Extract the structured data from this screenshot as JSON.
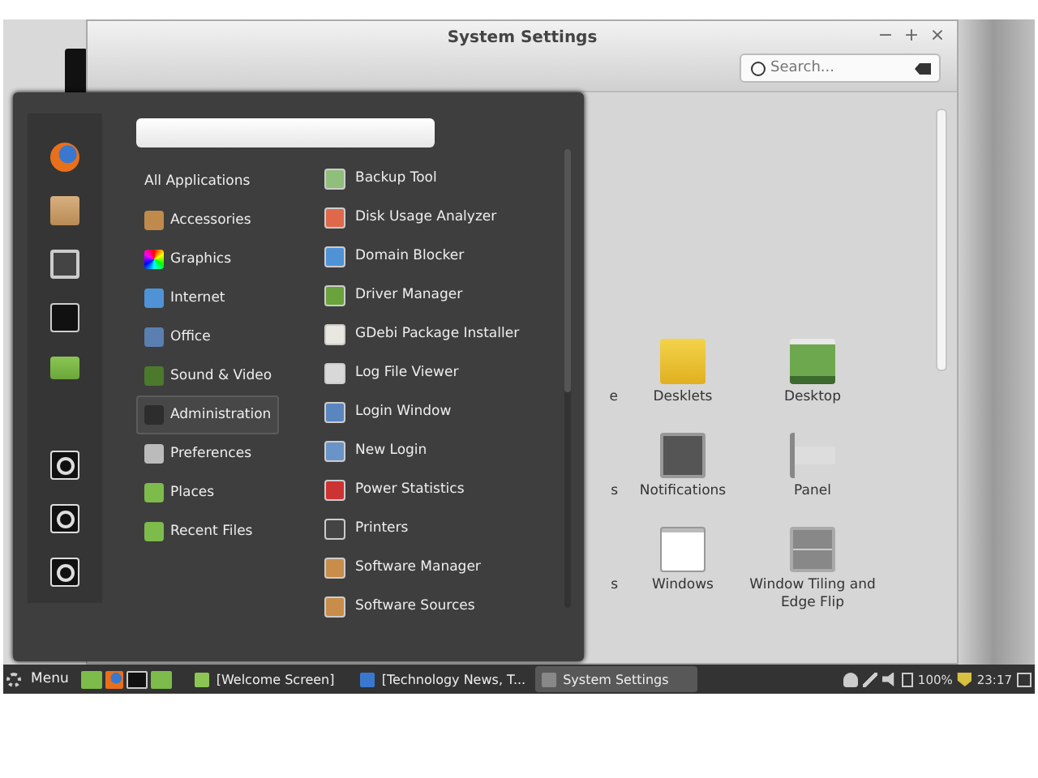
{
  "window": {
    "title": "System Settings",
    "controls": [
      "−",
      "+",
      "×"
    ],
    "search": {
      "placeholder": "Search..."
    }
  },
  "settings_items": [
    {
      "label": "e",
      "kind": "hidden"
    },
    {
      "label": "Desklets",
      "kind": "desklets"
    },
    {
      "label": "Desktop",
      "kind": "desktop"
    },
    {
      "label": "s",
      "kind": "hidden"
    },
    {
      "label": "Notifications",
      "kind": "notifications"
    },
    {
      "label": "Panel",
      "kind": "panel"
    },
    {
      "label": "s",
      "kind": "hidden"
    },
    {
      "label": "Windows",
      "kind": "windows"
    },
    {
      "label": "Window Tiling and Edge Flip",
      "kind": "tiling"
    }
  ],
  "menu": {
    "favorites": [
      {
        "kind": "firefox"
      },
      {
        "kind": "package"
      },
      {
        "kind": "settings"
      },
      {
        "kind": "terminal"
      },
      {
        "kind": "folder"
      },
      {
        "kind": "power"
      },
      {
        "kind": "power"
      },
      {
        "kind": "power"
      }
    ],
    "categories": [
      {
        "label": "All Applications",
        "kind": "none",
        "selected": false
      },
      {
        "label": "Accessories",
        "kind": "accessories",
        "selected": false
      },
      {
        "label": "Graphics",
        "kind": "graphics",
        "selected": false
      },
      {
        "label": "Internet",
        "kind": "internet",
        "selected": false
      },
      {
        "label": "Office",
        "kind": "office",
        "selected": false
      },
      {
        "label": "Sound & Video",
        "kind": "sound",
        "selected": false
      },
      {
        "label": "Administration",
        "kind": "admin",
        "selected": true
      },
      {
        "label": "Preferences",
        "kind": "prefs",
        "selected": false
      },
      {
        "label": "Places",
        "kind": "folder",
        "selected": false
      },
      {
        "label": "Recent Files",
        "kind": "folder",
        "selected": false
      }
    ],
    "apps": [
      {
        "label": "Backup Tool",
        "color": "#8fbf7a"
      },
      {
        "label": "Disk Usage Analyzer",
        "color": "#e0684a"
      },
      {
        "label": "Domain Blocker",
        "color": "#4f93d6"
      },
      {
        "label": "Driver Manager",
        "color": "#6aa33c"
      },
      {
        "label": "GDebi Package Installer",
        "color": "#e8e8e0"
      },
      {
        "label": "Log File Viewer",
        "color": "#d8d8d8"
      },
      {
        "label": "Login Window",
        "color": "#5a86c0"
      },
      {
        "label": "New Login",
        "color": "#6a94c8"
      },
      {
        "label": "Power Statistics",
        "color": "#cc3333"
      },
      {
        "label": "Printers",
        "color": "#444444"
      },
      {
        "label": "Software Manager",
        "color": "#c88d4a"
      },
      {
        "label": "Software Sources",
        "color": "#c88d4a"
      }
    ]
  },
  "taskbar": {
    "menu_label": "Menu",
    "windows": [
      {
        "label": "[Welcome Screen]",
        "selected": false
      },
      {
        "label": "[Technology News, T...",
        "selected": false
      },
      {
        "label": "System Settings",
        "selected": true
      }
    ],
    "battery": "100%",
    "clock": "23:17"
  }
}
